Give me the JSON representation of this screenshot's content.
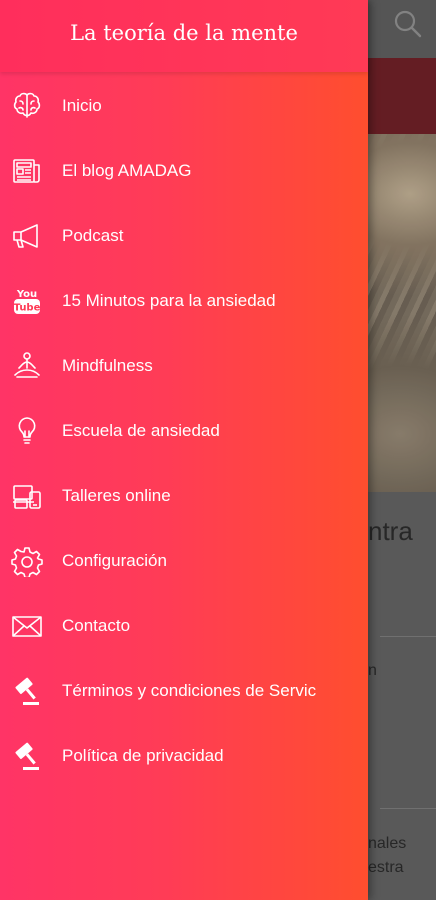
{
  "drawer": {
    "title": "La teoría de la mente",
    "items": [
      {
        "label": "Inicio",
        "icon": "brain-icon"
      },
      {
        "label": "El blog AMADAG",
        "icon": "newspaper-icon"
      },
      {
        "label": "Podcast",
        "icon": "megaphone-icon"
      },
      {
        "label": "15 Minutos para la ansiedad",
        "icon": "youtube-icon"
      },
      {
        "label": "Mindfulness",
        "icon": "meditation-icon"
      },
      {
        "label": "Escuela de ansiedad",
        "icon": "lightbulb-icon"
      },
      {
        "label": "Talleres online",
        "icon": "devices-icon"
      },
      {
        "label": "Configuración",
        "icon": "gear-icon"
      },
      {
        "label": "Contacto",
        "icon": "envelope-icon"
      },
      {
        "label": "Términos y condiciones de Servic",
        "icon": "gavel-icon"
      },
      {
        "label": "Política de privacidad",
        "icon": "gavel-icon"
      }
    ]
  },
  "background": {
    "search_icon": "search-icon",
    "headline_fragment": "ntra",
    "snippet_1": "n",
    "snippet_2_line1": "nales",
    "snippet_2_line2": "estra"
  },
  "colors": {
    "drawer_start": "#ff3466",
    "drawer_end": "#ff4e2e",
    "text": "#ffffff"
  }
}
